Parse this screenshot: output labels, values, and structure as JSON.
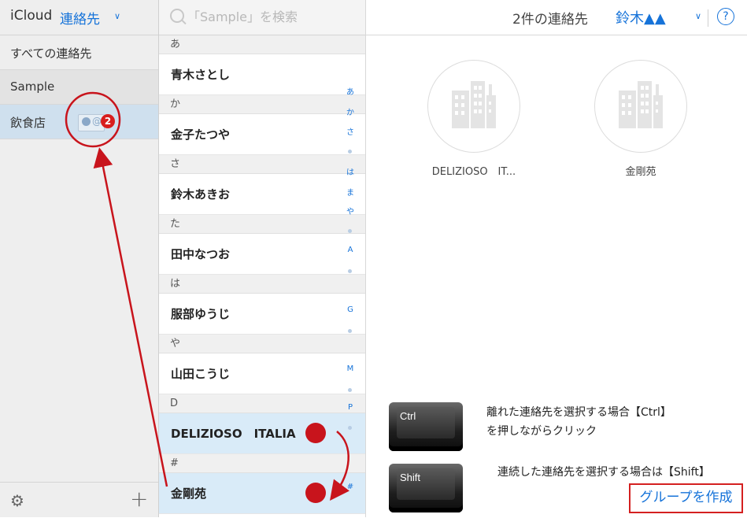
{
  "sidebar": {
    "title_prefix": "iCloud",
    "title": "連絡先",
    "groups": [
      {
        "label": "すべての連絡先"
      },
      {
        "label": "Sample"
      },
      {
        "label": "飲食店"
      }
    ],
    "drag_badge_count": "2"
  },
  "search": {
    "placeholder": "「Sample」を検索"
  },
  "contacts": {
    "sections": [
      {
        "header": "あ",
        "name": "青木さとし"
      },
      {
        "header": "か",
        "name": "金子たつや"
      },
      {
        "header": "さ",
        "name": "鈴木あきお"
      },
      {
        "header": "た",
        "name": "田中なつお"
      },
      {
        "header": "は",
        "name": "服部ゆうじ"
      },
      {
        "header": "や",
        "name": "山田こうじ"
      },
      {
        "header": "D",
        "name": "DELIZIOSO　ITALIA"
      },
      {
        "header": "#",
        "name": "金剛苑"
      }
    ],
    "index": [
      "あ",
      "か",
      "さ",
      "•",
      "は",
      "ま",
      "や",
      "•",
      "A",
      "•",
      "G",
      "•",
      "M",
      "•",
      "P",
      "•",
      "#"
    ]
  },
  "detail": {
    "count_label": "2件の連絡先",
    "user_name": "鈴木▲▲",
    "help_label": "?",
    "cards": [
      {
        "name": "DELIZIOSO　IT..."
      },
      {
        "name": "金剛苑"
      }
    ]
  },
  "annotations": {
    "ctrl_key": "Ctrl",
    "shift_key": "Shift",
    "ctrl_hint_line1": "離れた連絡先を選択する場合【Ctrl】",
    "ctrl_hint_line2": "を押しながらクリック",
    "shift_hint": "連続した連絡先を選択する場合は【Shift】"
  },
  "actions": {
    "create_group": "グループを作成"
  },
  "colors": {
    "accent": "#1673d9",
    "annotation_red": "#c8141c",
    "selected_row": "#d9ebf8"
  }
}
